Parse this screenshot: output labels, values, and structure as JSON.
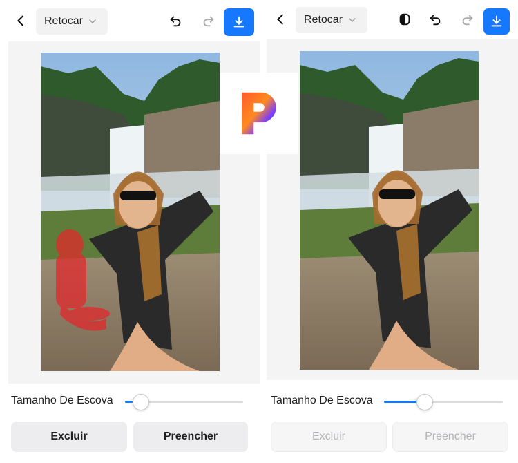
{
  "colors": {
    "accent": "#1677ff",
    "brush_mask": "#e5262a",
    "logo_gradient": [
      "#ff5a2c",
      "#ff8a1f",
      "#7a3cff",
      "#2b5cff"
    ]
  },
  "left_panel": {
    "toolbar": {
      "back_icon": "chevron-left-icon",
      "mode_label": "Retocar",
      "undo_icon": "undo-icon",
      "redo_icon": "redo-icon",
      "download_icon": "download-icon"
    },
    "canvas": {
      "state": "brush-selection",
      "mask_color": "red"
    },
    "brush": {
      "label": "Tamanho De Escova",
      "value_fraction": 0.07
    },
    "buttons": {
      "exclude": "Excluir",
      "fill": "Preencher",
      "enabled": true
    }
  },
  "right_panel": {
    "toolbar": {
      "back_icon": "chevron-left-icon",
      "mode_label": "Retocar",
      "compare_icon": "compare-icon",
      "undo_icon": "undo-icon",
      "redo_icon": "redo-icon",
      "download_icon": "download-icon"
    },
    "canvas": {
      "state": "object-removed"
    },
    "brush": {
      "label": "Tamanho De Escova",
      "value_fraction": 0.3
    },
    "buttons": {
      "exclude": "Excluir",
      "fill": "Preencher",
      "enabled": false
    }
  },
  "logo": {
    "name": "p-logo",
    "letter": "P"
  }
}
